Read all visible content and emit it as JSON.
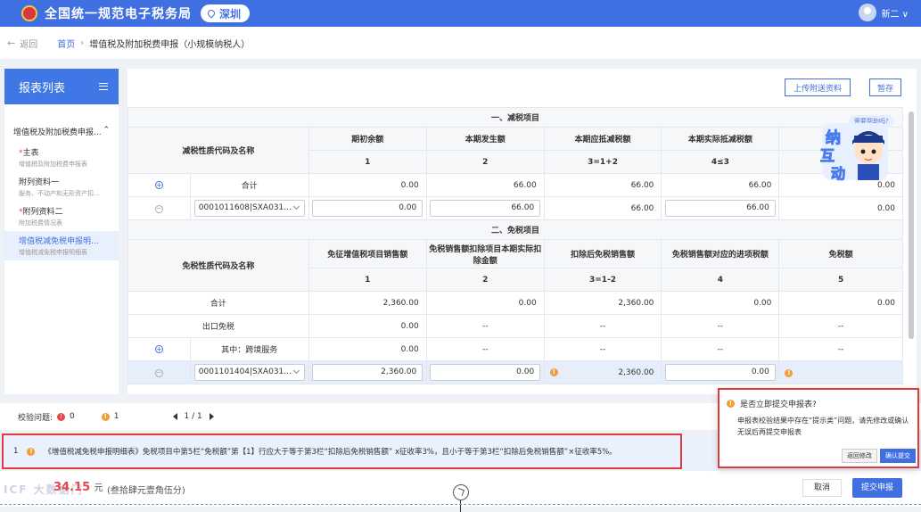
{
  "header": {
    "app_title": "全国统一规范电子税务局",
    "city": "深圳",
    "user": "新二 ∨"
  },
  "breadcrumb": {
    "back": "返回",
    "home": "首页",
    "current": "增值税及附加税费申报（小规模纳税人）"
  },
  "sidebar": {
    "title": "报表列表",
    "group": "增值税及附加税费申报...",
    "items": [
      {
        "label": "主表",
        "sub": "增值税及附加税费申报表",
        "required": "*"
      },
      {
        "label": "附列资料一",
        "sub": "服务、不动产和无形资产扣...",
        "required": ""
      },
      {
        "label": "附列资料二",
        "sub": "附加税费情况表",
        "required": "*"
      },
      {
        "label": "增值税减免税申报明...",
        "sub": "增值税减免税申报明细表",
        "required": ""
      }
    ]
  },
  "toolbar": {
    "upload": "上传附送资料",
    "save": "暂存"
  },
  "mascot": {
    "help": "需要帮助吗?",
    "text": "纳互动"
  },
  "section1": {
    "title": "一、减税项目",
    "cols": [
      "减税性质代码及名称",
      "期初余额",
      "本期发生额",
      "本期应抵减税额",
      "本期实际抵减税额"
    ],
    "nums": [
      "1",
      "2",
      "3=1+2",
      "4≤3"
    ],
    "total": {
      "label": "合计",
      "v1": "0.00",
      "v2": "66.00",
      "v3": "66.00",
      "v4": "66.00",
      "v5": "0.00"
    },
    "row": {
      "code": "0001011608|SXA031...",
      "v1": "0.00",
      "v2": "66.00",
      "v3": "66.00",
      "v4": "66.00",
      "v5": "0.00"
    }
  },
  "section2": {
    "title": "二、免税项目",
    "cols": [
      "免税性质代码及名称",
      "免征增值税项目销售额",
      "免税销售额扣除项目本期实际扣除金额",
      "扣除后免税销售额",
      "免税销售额对应的进项税额",
      "免税额"
    ],
    "nums": [
      "1",
      "2",
      "3=1-2",
      "4",
      "5"
    ],
    "total": {
      "label": "合计",
      "v1": "2,360.00",
      "v2": "0.00",
      "v3": "2,360.00",
      "v4": "0.00",
      "v5": "0.00"
    },
    "export": {
      "label": "出口免税",
      "v1": "0.00",
      "v2": "--",
      "v3": "--",
      "v4": "--",
      "v5": "--"
    },
    "cross": {
      "label": "其中：跨境服务",
      "v1": "0.00",
      "v2": "--",
      "v3": "--",
      "v4": "--",
      "v5": "--"
    },
    "row": {
      "code": "0001101404|SXA031...",
      "v1": "2,360.00",
      "v2": "0.00",
      "v3": "2,360.00",
      "v4": "0.00"
    }
  },
  "check": {
    "label": "校验问题:",
    "errors": "0",
    "warnings": "1",
    "page": "1 / 1"
  },
  "message": {
    "index": "1",
    "text": "《增值税减免税申报明细表》免税项目中第5栏“免税额”第【1】行应大于等于第3栏“扣除后免税销售额” x征收率3%，且小于等于第3栏“扣除后免税销售额”×征收率5%。"
  },
  "footer": {
    "amount": "34.15",
    "unit": "元",
    "amount_cn": "(叁拾肆元壹角伍分)",
    "cancel": "取消",
    "submit": "提交申报",
    "watermark": "ICF 大数据门"
  },
  "dialog": {
    "question": "是否立即提交申报表?",
    "body": "申报表校验结果中存在“提示类”问题，请先修改或确认无误后再提交申报表",
    "modify": "返回修改",
    "confirm": "确认提交"
  }
}
